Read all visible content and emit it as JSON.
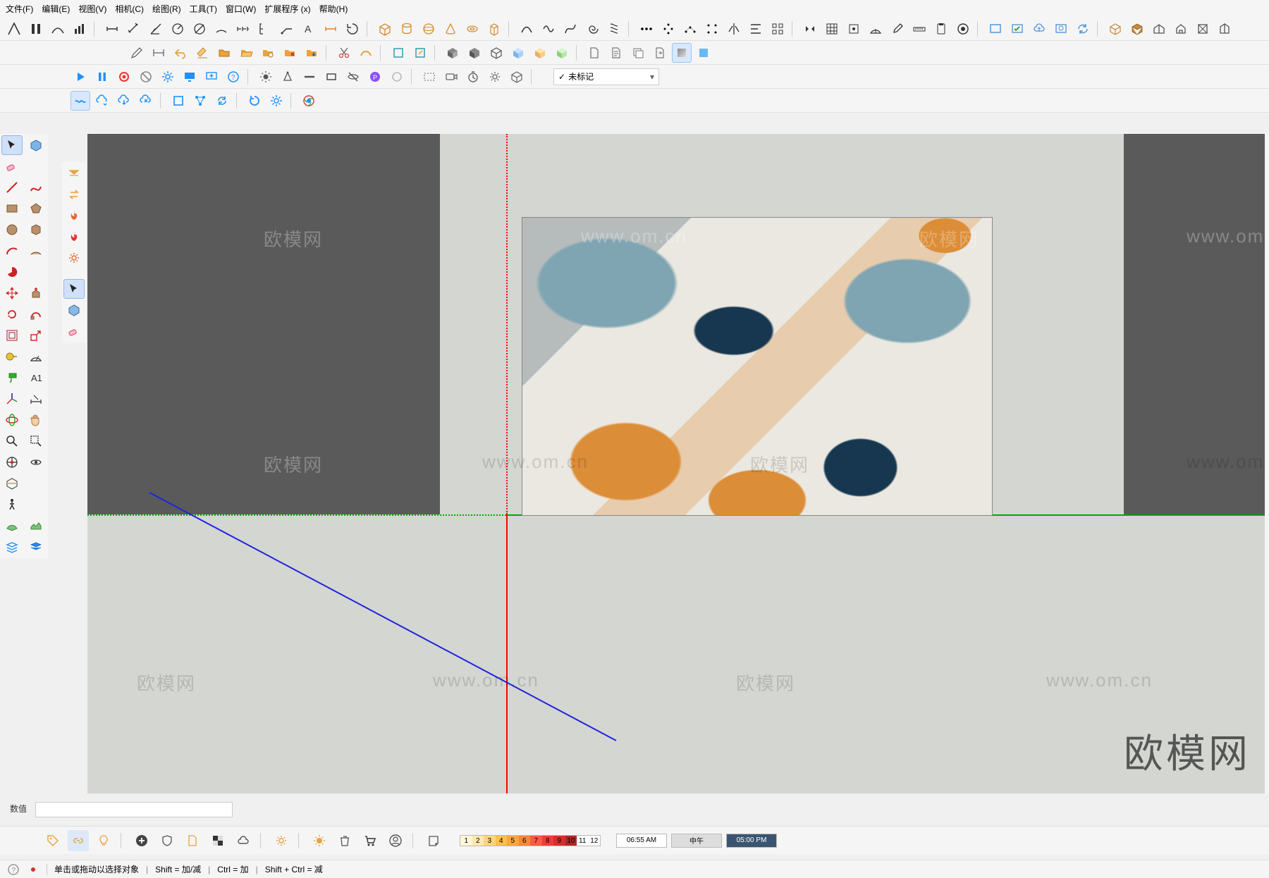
{
  "menu": {
    "file": "文件(F)",
    "edit": "编辑(E)",
    "view": "视图(V)",
    "camera": "相机(C)",
    "draw": "绘图(R)",
    "tools": "工具(T)",
    "window": "窗口(W)",
    "ext": "扩展程序 (x)",
    "help": "帮助(H)"
  },
  "tag_combo": "未标记",
  "vcb_label": "数值",
  "shadow": {
    "t1": "06:55 AM",
    "t2": "中午",
    "t3": "05:00 PM",
    "ticks": [
      "1",
      "2",
      "3",
      "4",
      "5",
      "6",
      "7",
      "8",
      "9",
      "10",
      "11",
      "12"
    ]
  },
  "status": {
    "hint": "单击或拖动以选择对象",
    "k1": "Shift = 加/减",
    "k2": "Ctrl = 加",
    "k3": "Shift + Ctrl = 减"
  },
  "wm": {
    "cn": "欧模网",
    "url": "www.om.cn"
  },
  "brand": "欧模网"
}
